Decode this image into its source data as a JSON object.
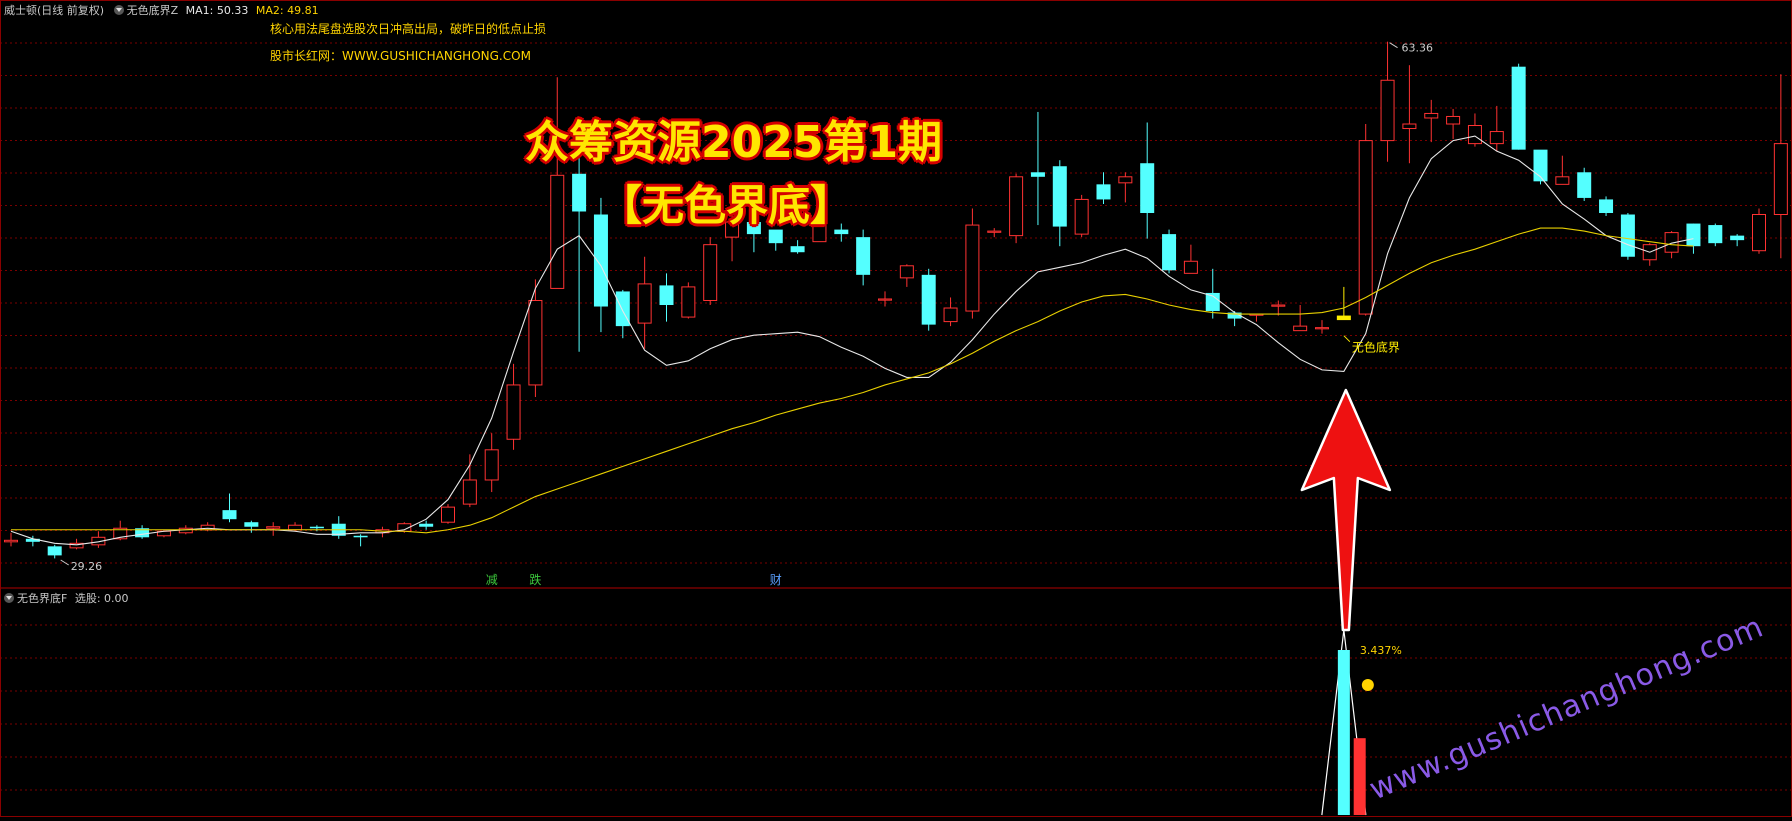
{
  "header": {
    "main_title": "威士顿(日线 前复权)",
    "indicator_name": "无色底界Z",
    "ma1": "MA1: 50.33",
    "ma2": "MA2: 49.81",
    "note1": "核心用法尾盘选股次日冲高出局，破昨日的低点止损",
    "note2": "股市长红网：WWW.GUSHICHANGHONG.COM",
    "restore_icon": "restore-icon"
  },
  "banner": {
    "line1": "众筹资源2025第1期",
    "line2": "【无色界底】"
  },
  "sub_header": {
    "indicator": "无色界底F",
    "value": "选股: 0.00"
  },
  "labels": {
    "signal": "无色底界",
    "high": "63.36",
    "low": "29.26",
    "pct": "3.437%",
    "ev1": "减",
    "ev2": "跌",
    "ev3": "财",
    "watermark": "www.gushichanghong.com"
  },
  "colors": {
    "up": "#ff3232",
    "down": "#54ffff",
    "signal": "#ffee00",
    "ma1": "#e8e8e8",
    "ma2": "#e8d000",
    "grid": "#7a0000",
    "watermark": "#8a5ae6",
    "arrow": "#ee1111"
  },
  "chart_data": {
    "type": "candlestick",
    "series": [
      {
        "name": "MA1",
        "values": [
          30.9,
          30.4,
          30.1,
          30.0,
          30.2,
          30.5,
          30.7,
          30.9,
          31.0,
          31.1,
          31.0,
          31.0,
          31.0,
          30.9,
          30.7,
          30.7,
          30.8,
          30.8,
          31.0,
          31.7,
          33.0,
          35.3,
          38.4,
          42.8,
          47.0,
          49.6,
          50.5,
          48.5,
          45.5,
          42.9,
          41.9,
          42.2,
          43.0,
          43.6,
          43.9,
          44.0,
          44.1,
          43.8,
          43.1,
          42.5,
          41.7,
          41.1,
          41.1,
          42.1,
          43.6,
          45.3,
          46.8,
          48.1,
          48.4,
          48.7,
          49.2,
          49.6,
          49.0,
          47.8,
          46.9,
          46.5,
          45.4,
          44.6,
          43.4,
          42.3,
          41.6,
          41.5,
          44.0,
          49.3,
          53.0,
          55.6,
          56.8,
          57.1,
          56.1,
          55.5,
          54.4,
          52.6,
          51.6,
          50.5,
          49.9,
          49.4,
          50.0,
          50.3
        ]
      },
      {
        "name": "MA2",
        "values": [
          31.0,
          31.0,
          31.0,
          31.0,
          31.0,
          31.0,
          31.0,
          31.0,
          31.0,
          31.0,
          31.0,
          31.0,
          31.0,
          31.0,
          31.0,
          31.0,
          31.0,
          30.9,
          30.9,
          30.8,
          31.0,
          31.3,
          31.8,
          32.5,
          33.2,
          33.7,
          34.2,
          34.7,
          35.2,
          35.7,
          36.2,
          36.7,
          37.2,
          37.7,
          38.1,
          38.6,
          39.0,
          39.4,
          39.7,
          40.1,
          40.6,
          41.0,
          41.4,
          42.0,
          42.7,
          43.5,
          44.2,
          44.8,
          45.5,
          46.1,
          46.5,
          46.6,
          46.3,
          45.9,
          45.6,
          45.4,
          45.3,
          45.3,
          45.3,
          45.3,
          45.4,
          45.7,
          46.4,
          47.2,
          48.0,
          48.7,
          49.2,
          49.6,
          50.1,
          50.6,
          51.0,
          51.0,
          50.8,
          50.5,
          50.3,
          50.1,
          49.9,
          49.81
        ]
      }
    ],
    "candles": [
      [
        30.2,
        30.3,
        29.9,
        30.8
      ],
      [
        30.4,
        30.2,
        29.9,
        30.6
      ],
      [
        29.9,
        29.3,
        29.1,
        30.0
      ],
      [
        29.8,
        30.1,
        29.7,
        30.4
      ],
      [
        30.0,
        30.5,
        29.8,
        30.9
      ],
      [
        30.4,
        31.1,
        30.3,
        31.6
      ],
      [
        31.1,
        30.5,
        30.4,
        31.3
      ],
      [
        30.6,
        30.9,
        30.5,
        31.0
      ],
      [
        30.8,
        31.1,
        30.7,
        31.3
      ],
      [
        31.0,
        31.3,
        30.9,
        31.5
      ],
      [
        32.3,
        31.7,
        31.5,
        33.4
      ],
      [
        31.5,
        31.2,
        30.8,
        31.6
      ],
      [
        31.1,
        31.2,
        30.6,
        31.5
      ],
      [
        31.0,
        31.3,
        30.9,
        31.5
      ],
      [
        31.2,
        31.1,
        30.9,
        31.3
      ],
      [
        31.4,
        30.6,
        30.4,
        31.9
      ],
      [
        30.6,
        30.5,
        29.9,
        30.7
      ],
      [
        30.8,
        31.0,
        30.5,
        31.2
      ],
      [
        30.9,
        31.4,
        30.8,
        31.5
      ],
      [
        31.4,
        31.2,
        31.0,
        31.6
      ],
      [
        31.5,
        32.5,
        31.4,
        32.7
      ],
      [
        32.7,
        34.3,
        32.5,
        36.0
      ],
      [
        34.3,
        36.3,
        33.5,
        37.4
      ],
      [
        37.0,
        40.6,
        36.3,
        42.0
      ],
      [
        40.6,
        46.2,
        39.8,
        47.6
      ],
      [
        47.0,
        54.5,
        47.0,
        61.0
      ],
      [
        54.6,
        52.1,
        42.8,
        56.1
      ],
      [
        51.9,
        45.8,
        44.1,
        53.0
      ],
      [
        46.8,
        44.5,
        43.7,
        46.9
      ],
      [
        44.7,
        47.3,
        43.0,
        49.1
      ],
      [
        47.2,
        45.9,
        44.8,
        48.0
      ],
      [
        45.1,
        47.1,
        45.0,
        47.4
      ],
      [
        46.2,
        49.9,
        45.9,
        50.4
      ],
      [
        50.4,
        51.4,
        48.8,
        52.6
      ],
      [
        51.4,
        50.6,
        49.4,
        51.6
      ],
      [
        50.9,
        50.0,
        49.5,
        50.3
      ],
      [
        49.8,
        49.4,
        49.3,
        50.2
      ],
      [
        50.1,
        51.3,
        50.1,
        51.4
      ],
      [
        50.9,
        50.6,
        50.1,
        51.3
      ],
      [
        50.4,
        47.9,
        47.2,
        50.9
      ],
      [
        46.3,
        46.3,
        45.8,
        46.8
      ],
      [
        47.7,
        48.5,
        47.1,
        48.6
      ],
      [
        47.9,
        44.6,
        44.2,
        48.3
      ],
      [
        44.8,
        45.7,
        44.5,
        46.4
      ],
      [
        45.5,
        51.2,
        45.0,
        52.3
      ],
      [
        50.8,
        50.8,
        50.4,
        51.0
      ],
      [
        50.5,
        54.4,
        50.0,
        54.6
      ],
      [
        54.7,
        54.4,
        51.2,
        58.7
      ],
      [
        55.1,
        51.1,
        49.8,
        55.5
      ],
      [
        50.6,
        52.9,
        50.4,
        53.2
      ],
      [
        53.9,
        52.9,
        52.6,
        54.7
      ],
      [
        54.0,
        54.4,
        52.7,
        54.7
      ],
      [
        55.3,
        52.0,
        50.3,
        58.0
      ],
      [
        50.6,
        48.2,
        48.0,
        50.9
      ],
      [
        48.0,
        48.8,
        48.0,
        49.9
      ],
      [
        46.7,
        45.5,
        45.0,
        48.3
      ],
      [
        45.4,
        45.0,
        44.5,
        45.5
      ],
      [
        45.3,
        45.3,
        44.8,
        45.3
      ],
      [
        45.9,
        45.9,
        45.2,
        46.2
      ],
      [
        44.2,
        44.5,
        44.4,
        45.9
      ],
      [
        44.4,
        44.4,
        44.0,
        44.9
      ],
      [
        45.2,
        44.9,
        45.0,
        47.1
      ],
      [
        45.3,
        56.8,
        45.2,
        57.9
      ],
      [
        56.8,
        60.8,
        55.4,
        63.36
      ],
      [
        57.6,
        57.9,
        55.3,
        61.8
      ],
      [
        58.3,
        58.6,
        56.7,
        59.5
      ],
      [
        57.9,
        58.4,
        56.9,
        58.9
      ],
      [
        56.6,
        57.8,
        56.4,
        58.6
      ],
      [
        56.6,
        57.4,
        56.1,
        59.1
      ],
      [
        61.7,
        56.2,
        56.2,
        61.9
      ],
      [
        56.2,
        54.1,
        53.9,
        55.8
      ],
      [
        53.9,
        54.4,
        54.1,
        55.8
      ],
      [
        54.7,
        53.0,
        52.8,
        55.0
      ],
      [
        52.9,
        52.0,
        51.8,
        53.1
      ],
      [
        51.9,
        49.1,
        48.9,
        52.0
      ],
      [
        48.9,
        49.9,
        48.5,
        50.0
      ],
      [
        49.4,
        50.7,
        49.0,
        50.8
      ],
      [
        51.3,
        49.8,
        49.3,
        51.3
      ],
      [
        51.2,
        50.0,
        49.8,
        51.3
      ],
      [
        50.5,
        50.2,
        49.8,
        50.6
      ],
      [
        49.5,
        51.9,
        49.3,
        52.3
      ],
      [
        51.9,
        56.6,
        49.0,
        61.2
      ]
    ],
    "signal_index": 61,
    "ylim": [
      28.0,
      64.0
    ],
    "sub_ylim": [
      0,
      3.437
    ],
    "sub_bars": [
      {
        "index": 61,
        "value": 3.437
      },
      {
        "index": 62,
        "value": 1.6
      }
    ]
  }
}
